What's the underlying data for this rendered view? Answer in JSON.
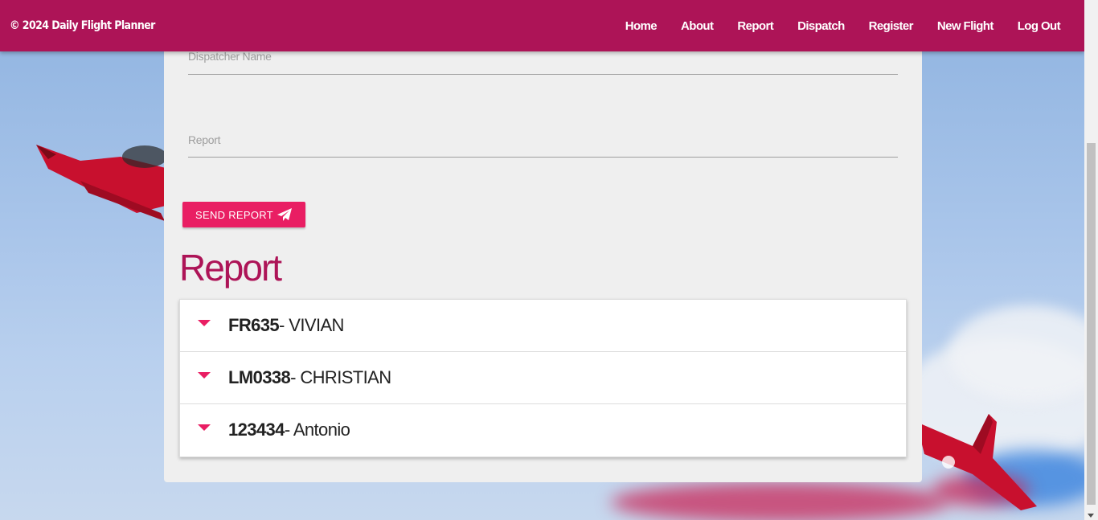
{
  "navbar": {
    "brand": "© 2024 Daily Flight Planner",
    "links": [
      "Home",
      "About",
      "Report",
      "Dispatch",
      "Register",
      "New Flight",
      "Log Out"
    ]
  },
  "form": {
    "dispatcher_label": "Dispatcher Name",
    "report_label": "Report",
    "send_button": "SEND REPORT",
    "send_icon": "paper-plane-icon"
  },
  "reports": {
    "title": "Report",
    "items": [
      {
        "code": "FR635",
        "name": "- VIVIAN"
      },
      {
        "code": "LM0338",
        "name": "- CHRISTIAN"
      },
      {
        "code": "123434",
        "name": "- Antonio"
      }
    ]
  },
  "colors": {
    "navbar": "#ad1457",
    "accent": "#e91e63",
    "card": "#efefef"
  }
}
